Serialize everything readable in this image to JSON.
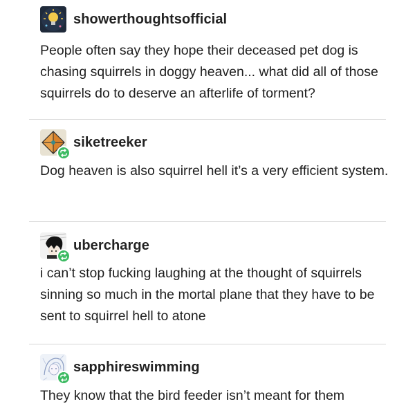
{
  "posts": [
    {
      "username": "showerthoughtsofficial",
      "text": "People often say they hope their deceased pet dog is chasing squirrels in doggy heaven... what did all of those squirrels do to deserve an afterlife of torment?",
      "avatar_icon": "lightbulb-avatar-icon",
      "reblogged": false
    },
    {
      "username": "siketreeker",
      "text": "Dog heaven is also squirrel hell it’s a very efficient system.",
      "avatar_icon": "diamond-avatar-icon",
      "reblogged": true
    },
    {
      "username": "ubercharge",
      "text": "i can’t stop fucking laughing at the thought of squirrels sinning so much in the mortal plane that they have to be sent to squirrel hell to atone",
      "avatar_icon": "manga-avatar-icon",
      "reblogged": true
    },
    {
      "username": "sapphireswimming",
      "text": "They know that the bird feeder isn’t meant for them",
      "avatar_icon": "sketch-avatar-icon",
      "reblogged": true
    }
  ],
  "colors": {
    "reblog_badge": "#3dbb63",
    "divider": "#d6d6d6",
    "text": "#1e1e1e"
  }
}
